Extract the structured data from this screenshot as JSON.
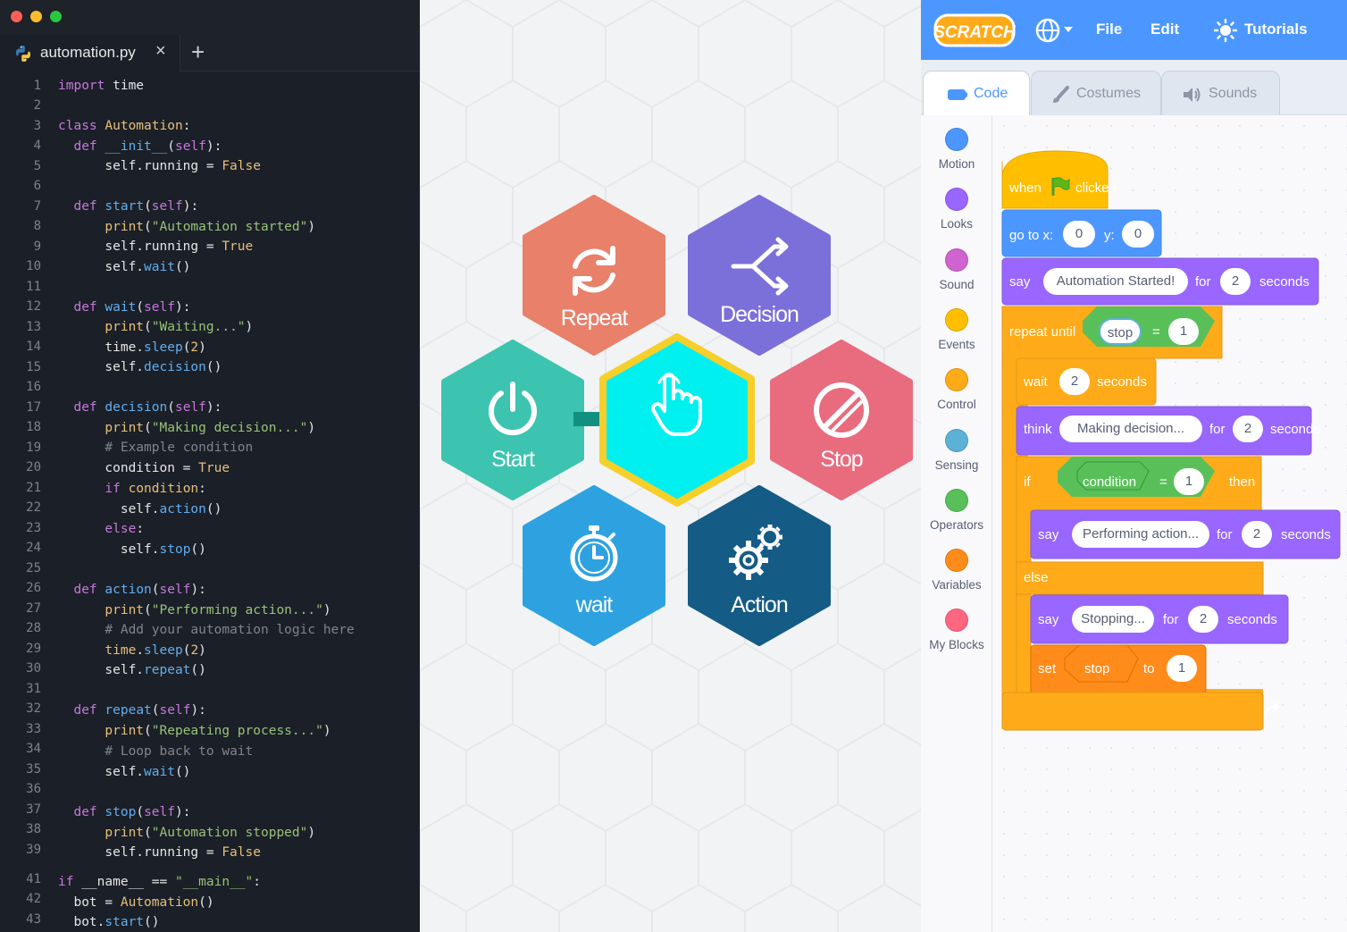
{
  "editor": {
    "tab_name": "automation.py",
    "close_glyph": "×",
    "new_tab_glyph": "+",
    "line_numbers": [
      "1",
      "2",
      "3",
      "4",
      "5",
      "6",
      "7",
      "8",
      "9",
      "10",
      "11",
      "12",
      "13",
      "14",
      "15",
      "16",
      "17",
      "18",
      "19",
      "20",
      "21",
      "22",
      "23",
      "24",
      "25",
      "26",
      "27",
      "28",
      "29",
      "30",
      "31",
      "32",
      "33",
      "34",
      "35",
      "36",
      "37",
      "38",
      "39",
      "41",
      "42",
      "43"
    ]
  },
  "hexes": {
    "repeat": "Repeat",
    "decision": "Decision",
    "start": "Start",
    "stop": "Stop",
    "wait": "wait",
    "action": "Action"
  },
  "scratch": {
    "logo_text": "SCRATCH",
    "menu": {
      "file": "File",
      "edit": "Edit",
      "tutorials": "Tutorials"
    },
    "tabs": {
      "code": "Code",
      "costumes": "Costumes",
      "sounds": "Sounds"
    },
    "categories": [
      {
        "label": "Motion",
        "color": "#4c97ff"
      },
      {
        "label": "Looks",
        "color": "#9966ff"
      },
      {
        "label": "Sound",
        "color": "#cf63cf"
      },
      {
        "label": "Events",
        "color": "#ffbf00"
      },
      {
        "label": "Control",
        "color": "#ffab19"
      },
      {
        "label": "Sensing",
        "color": "#5cb1d6"
      },
      {
        "label": "Operators",
        "color": "#59c059"
      },
      {
        "label": "Variables",
        "color": "#ff8c1a"
      },
      {
        "label": "My Blocks",
        "color": "#ff6680"
      }
    ],
    "blocks": {
      "when": "when",
      "clicked": "clicked",
      "goto": "go to x:",
      "goto_x": "0",
      "goto_y_label": "y:",
      "goto_y": "0",
      "say1": "say",
      "say1_text": "Automation Started!",
      "say1_for": "for",
      "say1_num": "2",
      "say1_secs": "seconds",
      "repeat_until": "repeat until",
      "stop_var": "stop",
      "eq1": "=",
      "eq1_val": "1",
      "wait": "wait",
      "wait_num": "2",
      "wait_secs": "seconds",
      "think": "think",
      "think_text": "Making decision...",
      "think_for": "for",
      "think_num": "2",
      "think_secs": "seconds",
      "if": "if",
      "condition": "condition",
      "eq2": "=",
      "eq2_val": "1",
      "then": "then",
      "say2": "say",
      "say2_text": "Performing action...",
      "say2_for": "for",
      "say2_num": "2",
      "say2_secs": "seconds",
      "else": "else",
      "say3": "say",
      "say3_text": "Stopping...",
      "say3_for": "for",
      "say3_num": "2",
      "say3_secs": "seconds",
      "set": "set",
      "set_var": "stop",
      "set_to": "to",
      "set_val": "1"
    }
  }
}
